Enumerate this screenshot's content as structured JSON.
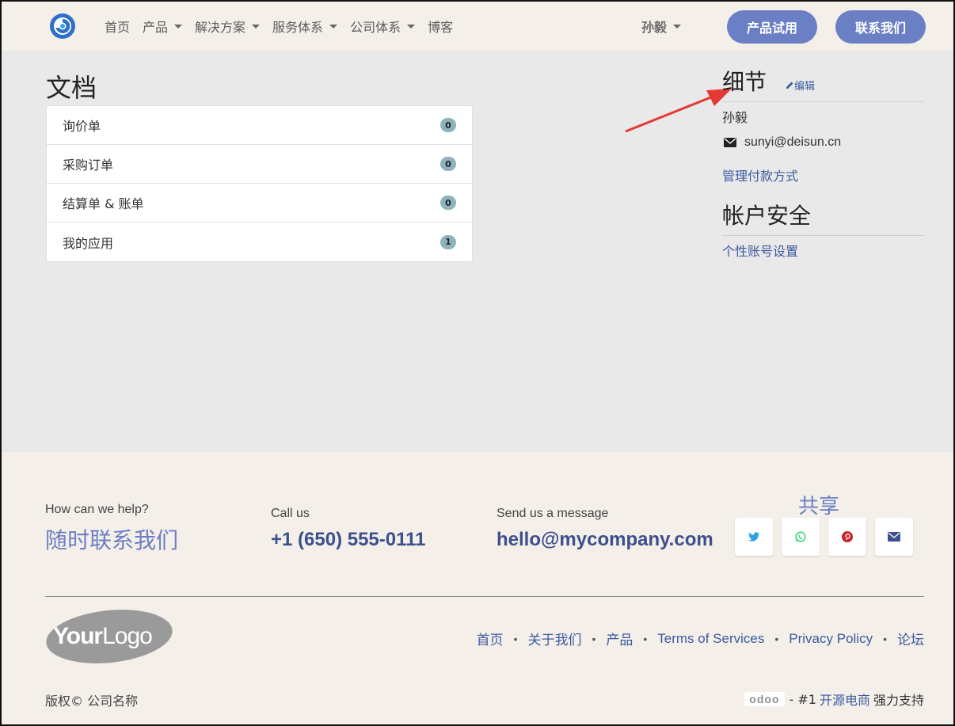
{
  "header": {
    "nav": [
      {
        "label": "首页",
        "dropdown": false
      },
      {
        "label": "产品",
        "dropdown": true
      },
      {
        "label": "解决方案",
        "dropdown": true
      },
      {
        "label": "服务体系",
        "dropdown": true
      },
      {
        "label": "公司体系",
        "dropdown": true
      },
      {
        "label": "博客",
        "dropdown": false
      }
    ],
    "user": "孙毅",
    "trial_button": "产品试用",
    "contact_button": "联系我们"
  },
  "documents": {
    "title": "文档",
    "items": [
      {
        "label": "询价单",
        "count": "0"
      },
      {
        "label": "采购订单",
        "count": "0"
      },
      {
        "label": "结算单 & 账单",
        "count": "0"
      },
      {
        "label": "我的应用",
        "count": "1"
      }
    ]
  },
  "details": {
    "title": "细节",
    "edit_label": "编辑",
    "name": "孙毅",
    "email": "sunyi@deisun.cn",
    "payment_link": "管理付款方式"
  },
  "security": {
    "title": "帐户安全",
    "settings_link": "个性账号设置"
  },
  "footer": {
    "help_prompt": "How can we help?",
    "help_title": "随时联系我们",
    "call_label": "Call us",
    "phone": "+1 (650) 555-0111",
    "message_label": "Send us a message",
    "email": "hello@mycompany.com",
    "share_title": "共享",
    "share_icons": [
      "twitter-icon",
      "whatsapp-icon",
      "pinterest-icon",
      "envelope-icon"
    ],
    "logo_text_bold": "Your",
    "logo_text_light": "Logo",
    "links": [
      "首页",
      "关于我们",
      "产品",
      "Terms of Services",
      "Privacy Policy",
      "论坛"
    ],
    "copyright": "版权© 公司名称",
    "powered_logo": "odoo",
    "powered_prefix": "- #1",
    "powered_link": "开源电商",
    "powered_suffix": "强力支持"
  },
  "colors": {
    "accent": "#6b7fc4",
    "link": "#3b5aa0",
    "badge": "#8fb3bd",
    "header_bg": "#f4efe9",
    "main_bg": "#e9e9e9",
    "arrow": "#e53935"
  }
}
